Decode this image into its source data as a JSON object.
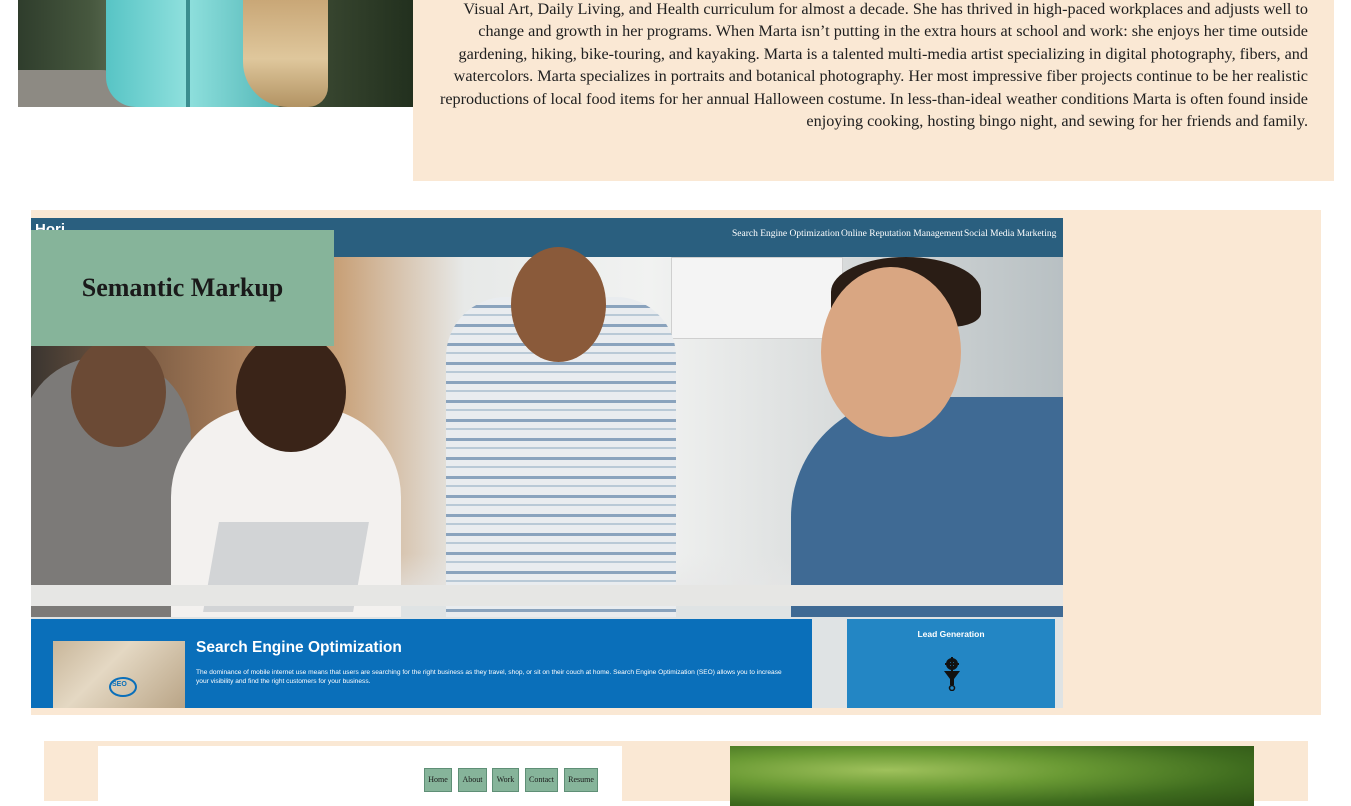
{
  "bio": {
    "text": "Visual Art, Daily Living, and Health curriculum for almost a decade. She has thrived in high-paced workplaces and adjusts well to change and growth in her programs. When Marta isn’t putting in the extra hours at school and work: she enjoys her time outside gardening, hiking, bike-touring, and kayaking. Marta is a talented multi-media artist specializing in digital photography, fibers, and watercolors. Marta specializes in portraits and botanical photography. Her most impressive fiber projects continue to be her realistic reproductions of local food items for her annual Halloween costume. In less-than-ideal weather conditions Marta is often found inside enjoying cooking, hosting bingo night, and sewing for her friends and family."
  },
  "project_seo": {
    "label": "Semantic Markup",
    "screenshot": {
      "logo": "Hori",
      "nav": [
        "Search Engine Optimization",
        "Online Reputation Management",
        "Social Media Marketing"
      ],
      "panel_title": "Search Engine Optimization",
      "panel_text": "The dominance of mobile internet use means that users are searching for the right business as they travel, shop, or sit on their couch at home. Search Engine Optimization (SEO) allows you to increase your visibility and find the right customers for your business.",
      "thumb_badge": "SEO",
      "side_title": "Lead Generation",
      "side_icon": "funnel-gear-icon"
    }
  },
  "project_portfolio": {
    "mini_nav": [
      "Home",
      "About",
      "Work",
      "Contact",
      "Resume"
    ]
  },
  "colors": {
    "card_bg": "#fae8d4",
    "label_bg": "#86b49a",
    "seo_blue": "#0a6fba",
    "nav_blue": "#2a5f7f"
  }
}
